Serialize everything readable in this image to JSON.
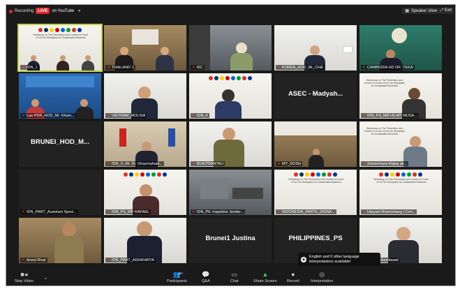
{
  "topbar": {
    "recording_label": "Recording",
    "live_badge": "LIVE",
    "live_destination": "on YouTube",
    "speaker_view_label": "Speaker View",
    "exit_label": "Exit"
  },
  "participants": [
    {
      "name": "IDN_1",
      "muted": true
    },
    {
      "name": "THAILAND 1",
      "muted": true
    },
    {
      "name": "MC",
      "muted": true
    },
    {
      "name": "KOREA_HOD_Mr_CHA",
      "muted": true
    },
    {
      "name": "CAMBODIA HD DR. YEKA",
      "muted": true
    },
    {
      "name": "Lao PDR_HOD_Mr. Kham...",
      "muted": true
    },
    {
      "name": "VIETNAM_MOLISA",
      "muted": true
    },
    {
      "name": "IDN_4",
      "muted": true
    },
    {
      "name": "ASEC - Madyah...",
      "muted": false,
      "name_only": true
    },
    {
      "name": "IDN_PS_MR HILMY MUSA...",
      "muted": true
    },
    {
      "name": "BRUNEI_HOD_M...",
      "muted": false,
      "name_only": true
    },
    {
      "name": "IDN_S_Mr. Dr. Ghazmahadi...",
      "muted": true
    },
    {
      "name": "BUKITBANTAU",
      "muted": true
    },
    {
      "name": "MY_DOSH",
      "muted": true
    },
    {
      "name": "Zamermans Rajag ak...",
      "muted": true
    },
    {
      "name": "IDN_PART_Assistant Speci...",
      "muted": true
    },
    {
      "name": "IDN_PS_MR RAFAEL",
      "muted": true
    },
    {
      "name": "IDN_Plt. Inspektur Jender...",
      "muted": true
    },
    {
      "name": "INDONESIA_PARTE_DISNA...",
      "muted": true
    },
    {
      "name": "Haryani Riamontang | Ceri...",
      "muted": true
    },
    {
      "name": "Arizal Rivai",
      "muted": true
    },
    {
      "name": "IDN_PART_ADHIKARYA",
      "muted": true
    },
    {
      "name": "Brunei1 Justina",
      "muted": false,
      "name_only": true
    },
    {
      "name": "PHILIPPINES_PS",
      "muted": false,
      "name_only": true
    },
    {
      "name": "Henny Mustikasari",
      "muted": true
    }
  ],
  "tile_banner_text": "Workshop on The Prevention and Control of Covid-19 at The Workplace for Sustainable Business",
  "tooltip": {
    "text": "English and 0 other language interpretations available!"
  },
  "controls": {
    "stop_video": "Stop Video",
    "participants": "Participants",
    "participants_count": "90",
    "qa": "Q&A",
    "chat": "Chat",
    "share_screen": "Share Screen",
    "record": "Record",
    "interpretation": "Interpretation"
  },
  "colors": {
    "live_red": "#e0262d",
    "active_speaker": "#c2d14a",
    "share_green": "#3fcf6a"
  }
}
